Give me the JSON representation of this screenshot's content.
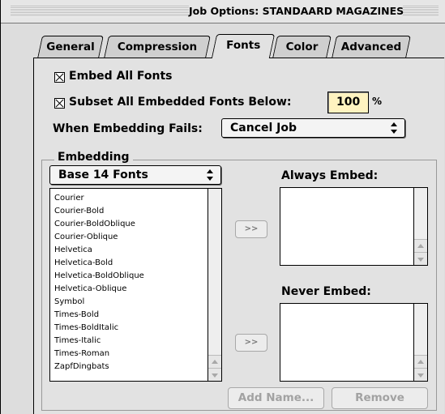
{
  "window": {
    "title": "Job Options: STANDAARD MAGAZINES"
  },
  "tabs": [
    {
      "label": "General"
    },
    {
      "label": "Compression"
    },
    {
      "label": "Fonts"
    },
    {
      "label": "Color"
    },
    {
      "label": "Advanced"
    }
  ],
  "active_tab": "Fonts",
  "fonts_tab": {
    "embed_all": {
      "label": "Embed All Fonts",
      "checked": true
    },
    "subset_below": {
      "label": "Subset All Embedded Fonts Below:",
      "checked": true,
      "value": "100",
      "unit": "%"
    },
    "when_fails": {
      "label": "When Embedding Fails:",
      "value": "Cancel Job"
    },
    "embedding": {
      "group_label": "Embedding",
      "source_popup": "Base 14 Fonts",
      "font_list": [
        "Courier",
        "Courier-Bold",
        "Courier-BoldOblique",
        "Courier-Oblique",
        "Helvetica",
        "Helvetica-Bold",
        "Helvetica-BoldOblique",
        "Helvetica-Oblique",
        "Symbol",
        "Times-Bold",
        "Times-BoldItalic",
        "Times-Italic",
        "Times-Roman",
        "ZapfDingbats"
      ],
      "always_embed_label": "Always Embed:",
      "never_embed_label": "Never Embed:",
      "move_button_label": ">>",
      "add_name_label": "Add Name...",
      "remove_label": "Remove"
    }
  }
}
